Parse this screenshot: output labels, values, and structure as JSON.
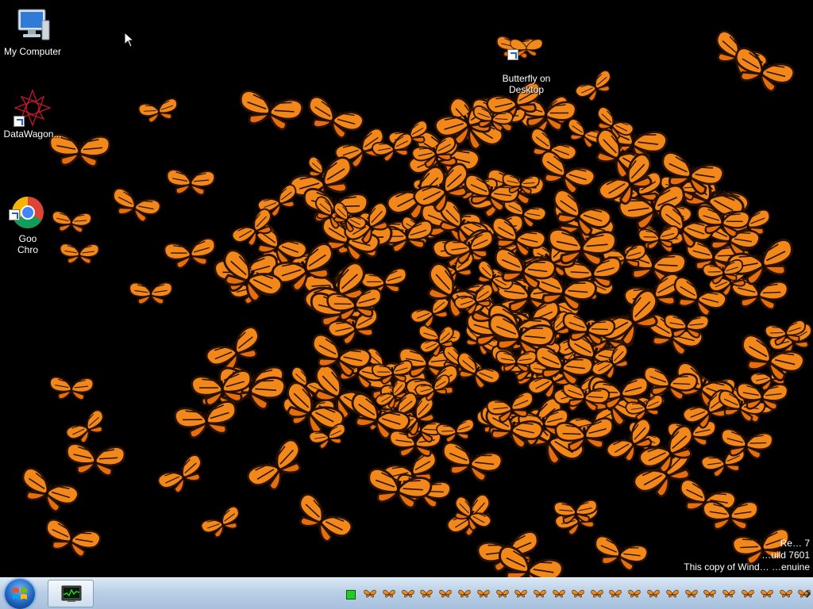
{
  "desktop": {
    "background": "#000000",
    "accent": "#ff8c1a",
    "icons": [
      {
        "label": "My Computer",
        "icon": "my-computer-icon"
      },
      {
        "label": "DataWagon...",
        "icon": "datawagon-icon"
      },
      {
        "label": "Goo\nChro",
        "icon": "google-chrome-icon"
      },
      {
        "label": "Butterfly on\nDesktop",
        "icon": "butterfly-on-desktop-icon"
      }
    ],
    "watermark": {
      "line1": "Re… 7",
      "line2": "…uild 7601",
      "line3": "This copy of Wind… …enuine"
    }
  },
  "taskbar": {
    "start_icon": "windows-start-orb",
    "app_icon": "task-manager-icon",
    "tray_butterfly_count": 24,
    "tray_status_color": "#22cc22"
  }
}
